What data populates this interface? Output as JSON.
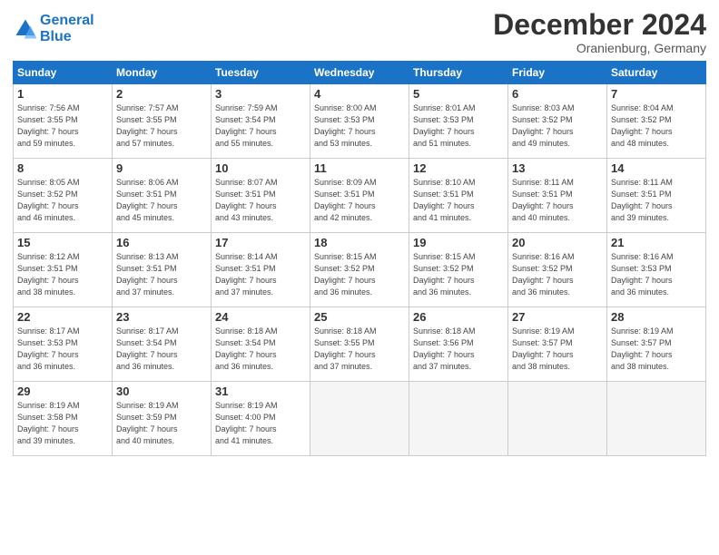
{
  "header": {
    "logo_line1": "General",
    "logo_line2": "Blue",
    "month": "December 2024",
    "location": "Oranienburg, Germany"
  },
  "days_of_week": [
    "Sunday",
    "Monday",
    "Tuesday",
    "Wednesday",
    "Thursday",
    "Friday",
    "Saturday"
  ],
  "weeks": [
    [
      {
        "num": "1",
        "sunrise": "Sunrise: 7:56 AM",
        "sunset": "Sunset: 3:55 PM",
        "daylight": "Daylight: 7 hours and 59 minutes."
      },
      {
        "num": "2",
        "sunrise": "Sunrise: 7:57 AM",
        "sunset": "Sunset: 3:55 PM",
        "daylight": "Daylight: 7 hours and 57 minutes."
      },
      {
        "num": "3",
        "sunrise": "Sunrise: 7:59 AM",
        "sunset": "Sunset: 3:54 PM",
        "daylight": "Daylight: 7 hours and 55 minutes."
      },
      {
        "num": "4",
        "sunrise": "Sunrise: 8:00 AM",
        "sunset": "Sunset: 3:53 PM",
        "daylight": "Daylight: 7 hours and 53 minutes."
      },
      {
        "num": "5",
        "sunrise": "Sunrise: 8:01 AM",
        "sunset": "Sunset: 3:53 PM",
        "daylight": "Daylight: 7 hours and 51 minutes."
      },
      {
        "num": "6",
        "sunrise": "Sunrise: 8:03 AM",
        "sunset": "Sunset: 3:52 PM",
        "daylight": "Daylight: 7 hours and 49 minutes."
      },
      {
        "num": "7",
        "sunrise": "Sunrise: 8:04 AM",
        "sunset": "Sunset: 3:52 PM",
        "daylight": "Daylight: 7 hours and 48 minutes."
      }
    ],
    [
      {
        "num": "8",
        "sunrise": "Sunrise: 8:05 AM",
        "sunset": "Sunset: 3:52 PM",
        "daylight": "Daylight: 7 hours and 46 minutes."
      },
      {
        "num": "9",
        "sunrise": "Sunrise: 8:06 AM",
        "sunset": "Sunset: 3:51 PM",
        "daylight": "Daylight: 7 hours and 45 minutes."
      },
      {
        "num": "10",
        "sunrise": "Sunrise: 8:07 AM",
        "sunset": "Sunset: 3:51 PM",
        "daylight": "Daylight: 7 hours and 43 minutes."
      },
      {
        "num": "11",
        "sunrise": "Sunrise: 8:09 AM",
        "sunset": "Sunset: 3:51 PM",
        "daylight": "Daylight: 7 hours and 42 minutes."
      },
      {
        "num": "12",
        "sunrise": "Sunrise: 8:10 AM",
        "sunset": "Sunset: 3:51 PM",
        "daylight": "Daylight: 7 hours and 41 minutes."
      },
      {
        "num": "13",
        "sunrise": "Sunrise: 8:11 AM",
        "sunset": "Sunset: 3:51 PM",
        "daylight": "Daylight: 7 hours and 40 minutes."
      },
      {
        "num": "14",
        "sunrise": "Sunrise: 8:11 AM",
        "sunset": "Sunset: 3:51 PM",
        "daylight": "Daylight: 7 hours and 39 minutes."
      }
    ],
    [
      {
        "num": "15",
        "sunrise": "Sunrise: 8:12 AM",
        "sunset": "Sunset: 3:51 PM",
        "daylight": "Daylight: 7 hours and 38 minutes."
      },
      {
        "num": "16",
        "sunrise": "Sunrise: 8:13 AM",
        "sunset": "Sunset: 3:51 PM",
        "daylight": "Daylight: 7 hours and 37 minutes."
      },
      {
        "num": "17",
        "sunrise": "Sunrise: 8:14 AM",
        "sunset": "Sunset: 3:51 PM",
        "daylight": "Daylight: 7 hours and 37 minutes."
      },
      {
        "num": "18",
        "sunrise": "Sunrise: 8:15 AM",
        "sunset": "Sunset: 3:52 PM",
        "daylight": "Daylight: 7 hours and 36 minutes."
      },
      {
        "num": "19",
        "sunrise": "Sunrise: 8:15 AM",
        "sunset": "Sunset: 3:52 PM",
        "daylight": "Daylight: 7 hours and 36 minutes."
      },
      {
        "num": "20",
        "sunrise": "Sunrise: 8:16 AM",
        "sunset": "Sunset: 3:52 PM",
        "daylight": "Daylight: 7 hours and 36 minutes."
      },
      {
        "num": "21",
        "sunrise": "Sunrise: 8:16 AM",
        "sunset": "Sunset: 3:53 PM",
        "daylight": "Daylight: 7 hours and 36 minutes."
      }
    ],
    [
      {
        "num": "22",
        "sunrise": "Sunrise: 8:17 AM",
        "sunset": "Sunset: 3:53 PM",
        "daylight": "Daylight: 7 hours and 36 minutes."
      },
      {
        "num": "23",
        "sunrise": "Sunrise: 8:17 AM",
        "sunset": "Sunset: 3:54 PM",
        "daylight": "Daylight: 7 hours and 36 minutes."
      },
      {
        "num": "24",
        "sunrise": "Sunrise: 8:18 AM",
        "sunset": "Sunset: 3:54 PM",
        "daylight": "Daylight: 7 hours and 36 minutes."
      },
      {
        "num": "25",
        "sunrise": "Sunrise: 8:18 AM",
        "sunset": "Sunset: 3:55 PM",
        "daylight": "Daylight: 7 hours and 37 minutes."
      },
      {
        "num": "26",
        "sunrise": "Sunrise: 8:18 AM",
        "sunset": "Sunset: 3:56 PM",
        "daylight": "Daylight: 7 hours and 37 minutes."
      },
      {
        "num": "27",
        "sunrise": "Sunrise: 8:19 AM",
        "sunset": "Sunset: 3:57 PM",
        "daylight": "Daylight: 7 hours and 38 minutes."
      },
      {
        "num": "28",
        "sunrise": "Sunrise: 8:19 AM",
        "sunset": "Sunset: 3:57 PM",
        "daylight": "Daylight: 7 hours and 38 minutes."
      }
    ],
    [
      {
        "num": "29",
        "sunrise": "Sunrise: 8:19 AM",
        "sunset": "Sunset: 3:58 PM",
        "daylight": "Daylight: 7 hours and 39 minutes."
      },
      {
        "num": "30",
        "sunrise": "Sunrise: 8:19 AM",
        "sunset": "Sunset: 3:59 PM",
        "daylight": "Daylight: 7 hours and 40 minutes."
      },
      {
        "num": "31",
        "sunrise": "Sunrise: 8:19 AM",
        "sunset": "Sunset: 4:00 PM",
        "daylight": "Daylight: 7 hours and 41 minutes."
      },
      null,
      null,
      null,
      null
    ]
  ]
}
